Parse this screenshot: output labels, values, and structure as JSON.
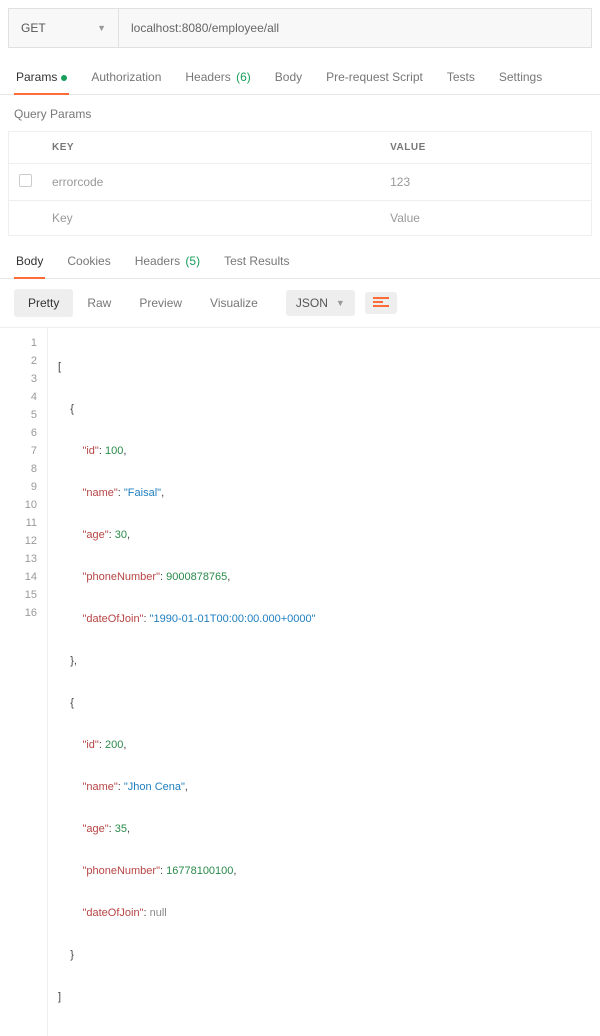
{
  "request": {
    "method": "GET",
    "url": "localhost:8080/employee/all"
  },
  "req_tabs": {
    "params": "Params",
    "authorization": "Authorization",
    "headers": "Headers",
    "headers_count": "(6)",
    "body": "Body",
    "prerequest": "Pre-request Script",
    "tests": "Tests",
    "settings": "Settings"
  },
  "query_params": {
    "title": "Query Params",
    "col_key": "KEY",
    "col_value": "VALUE",
    "rows": [
      {
        "key": "errorcode",
        "value": "123"
      }
    ],
    "placeholder_key": "Key",
    "placeholder_value": "Value"
  },
  "resp_tabs": {
    "body": "Body",
    "cookies": "Cookies",
    "headers": "Headers",
    "headers_count": "(5)",
    "test_results": "Test Results"
  },
  "toolbar": {
    "pretty": "Pretty",
    "raw": "Raw",
    "preview": "Preview",
    "visualize": "Visualize",
    "format": "JSON"
  },
  "code": {
    "lines": [
      "1",
      "2",
      "3",
      "4",
      "5",
      "6",
      "7",
      "8",
      "9",
      "10",
      "11",
      "12",
      "13",
      "14",
      "15",
      "16"
    ],
    "l1": "[",
    "l2": "    {",
    "l3k": "\"id\"",
    "l3v": "100",
    "l4k": "\"name\"",
    "l4v": "\"Faisal\"",
    "l5k": "\"age\"",
    "l5v": "30",
    "l6k": "\"phoneNumber\"",
    "l6v": "9000878765",
    "l7k": "\"dateOfJoin\"",
    "l7v": "\"1990-01-01T00:00:00.000+0000\"",
    "l8": "    },",
    "l9": "    {",
    "l10k": "\"id\"",
    "l10v": "200",
    "l11k": "\"name\"",
    "l11v": "\"Jhon Cena\"",
    "l12k": "\"age\"",
    "l12v": "35",
    "l13k": "\"phoneNumber\"",
    "l13v": "16778100100",
    "l14k": "\"dateOfJoin\"",
    "l14v": "null",
    "l15": "    }",
    "l16": "]"
  }
}
